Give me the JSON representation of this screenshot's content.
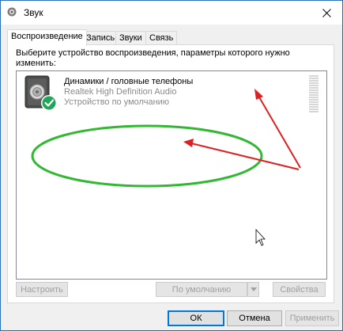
{
  "window": {
    "title": "Звук",
    "icon": "speaker-round-icon",
    "close_glyph": "✕"
  },
  "tabs": [
    {
      "label": "Воспроизведение",
      "active": true
    },
    {
      "label": "Запись",
      "active": false
    },
    {
      "label": "Звуки",
      "active": false
    },
    {
      "label": "Связь",
      "active": false
    }
  ],
  "panel": {
    "instruction": "Выберите устройство воспроизведения, параметры которого нужно изменить:"
  },
  "devices": [
    {
      "name": "Динамики / головные телефоны",
      "driver": "Realtek High Definition Audio",
      "status": "Устройство по умолчанию",
      "icon": "speaker-icon",
      "badge": "default-check-icon"
    }
  ],
  "buttons": {
    "configure": "Настроить",
    "set_default": "По умолчанию",
    "properties": "Свойства",
    "ok": "ОК",
    "cancel": "Отмена",
    "apply": "Применить"
  },
  "colors": {
    "accent_border": "#0078d7",
    "annotation_arrow": "#e02020",
    "annotation_ellipse": "#33b833",
    "check_badge": "#22a55a"
  }
}
